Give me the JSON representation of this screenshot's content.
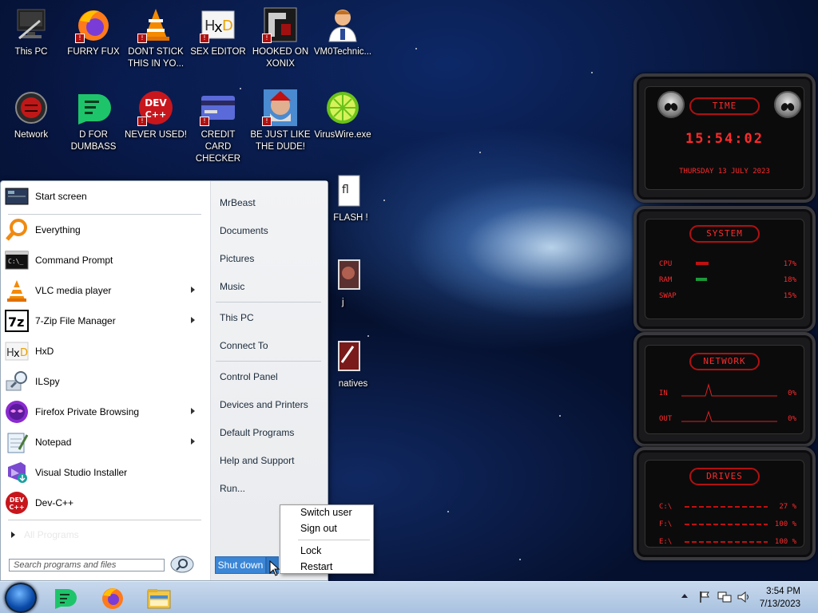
{
  "desktop_icons": [
    {
      "label": "This PC",
      "icon": "computer-icon"
    },
    {
      "label": "FURRY FUX",
      "icon": "firefox-icon"
    },
    {
      "label": "DONT STICK\nTHIS IN YO...",
      "icon": "vlc-icon"
    },
    {
      "label": "SEX EDITOR",
      "icon": "hxd-icon"
    },
    {
      "label": "HOOKED ON\nXONIX",
      "icon": "game-icon"
    },
    {
      "label": "VM0Technic...",
      "icon": "doctor-icon"
    },
    {
      "label": "Network",
      "icon": "network-icon"
    },
    {
      "label": "D FOR\nDUMBASS",
      "icon": "d-app-icon"
    },
    {
      "label": "NEVER USED!",
      "icon": "devcpp-icon"
    },
    {
      "label": "CREDIT CARD\nCHECKER",
      "icon": "credit-card-icon"
    },
    {
      "label": "BE JUST LIKE\nTHE DUDE!",
      "icon": "dude-icon"
    },
    {
      "label": "VirusWire.exe",
      "icon": "lime-icon"
    },
    {
      "label": "FLASH !",
      "icon": "flash-icon"
    },
    {
      "label": "j",
      "icon": "image-icon"
    },
    {
      "label": "natives",
      "icon": "natives-icon"
    }
  ],
  "gadget": {
    "time_title": "TIME",
    "time": "15:54:02",
    "date": "THURSDAY 13 JULY 2023",
    "system_title": "SYSTEM",
    "cpu_label": "CPU",
    "cpu_value": "17%",
    "ram_label": "RAM",
    "ram_value": "18%",
    "swap_label": "SWAP",
    "swap_value": "15%",
    "network_title": "NETWORK",
    "in_label": "IN",
    "in_value": "0%",
    "out_label": "OUT",
    "out_value": "0%",
    "drives_title": "DRIVES",
    "c_label": "C:\\",
    "c_value": "27 %",
    "f_label": "F:\\",
    "f_value": "100 %",
    "e_label": "E:\\",
    "e_value": "100 %"
  },
  "start_menu": {
    "programs": [
      {
        "label": "Start screen",
        "icon": "start-screen-icon",
        "submenu": false
      },
      {
        "label": "Everything",
        "icon": "everything-icon",
        "submenu": false
      },
      {
        "label": "Command Prompt",
        "icon": "cmd-icon",
        "submenu": false
      },
      {
        "label": "VLC media player",
        "icon": "vlc-icon",
        "submenu": true
      },
      {
        "label": "7-Zip File Manager",
        "icon": "7zip-icon",
        "submenu": true
      },
      {
        "label": "HxD",
        "icon": "hxd-icon",
        "submenu": false
      },
      {
        "label": "ILSpy",
        "icon": "ilspy-icon",
        "submenu": false
      },
      {
        "label": "Firefox Private Browsing",
        "icon": "firefox-private-icon",
        "submenu": true
      },
      {
        "label": "Notepad",
        "icon": "notepad-icon",
        "submenu": true
      },
      {
        "label": "Visual Studio Installer",
        "icon": "vs-installer-icon",
        "submenu": false
      },
      {
        "label": "Dev-C++",
        "icon": "devcpp-icon",
        "submenu": false
      }
    ],
    "all_programs": "All Programs",
    "search_placeholder": "Search programs and files",
    "right_links": [
      "MrBeast",
      "Documents",
      "Pictures",
      "Music",
      "This PC",
      "Connect To",
      "Control Panel",
      "Devices and Printers",
      "Default Programs",
      "Help and Support",
      "Run..."
    ],
    "shutdown_label": "Shut down",
    "power_menu": [
      "Switch user",
      "Sign out",
      "Lock",
      "Restart"
    ]
  },
  "taskbar": {
    "pinned": [
      "d-app-icon",
      "firefox-icon",
      "file-explorer-icon"
    ],
    "time": "3:54 PM",
    "date": "7/13/2023"
  }
}
